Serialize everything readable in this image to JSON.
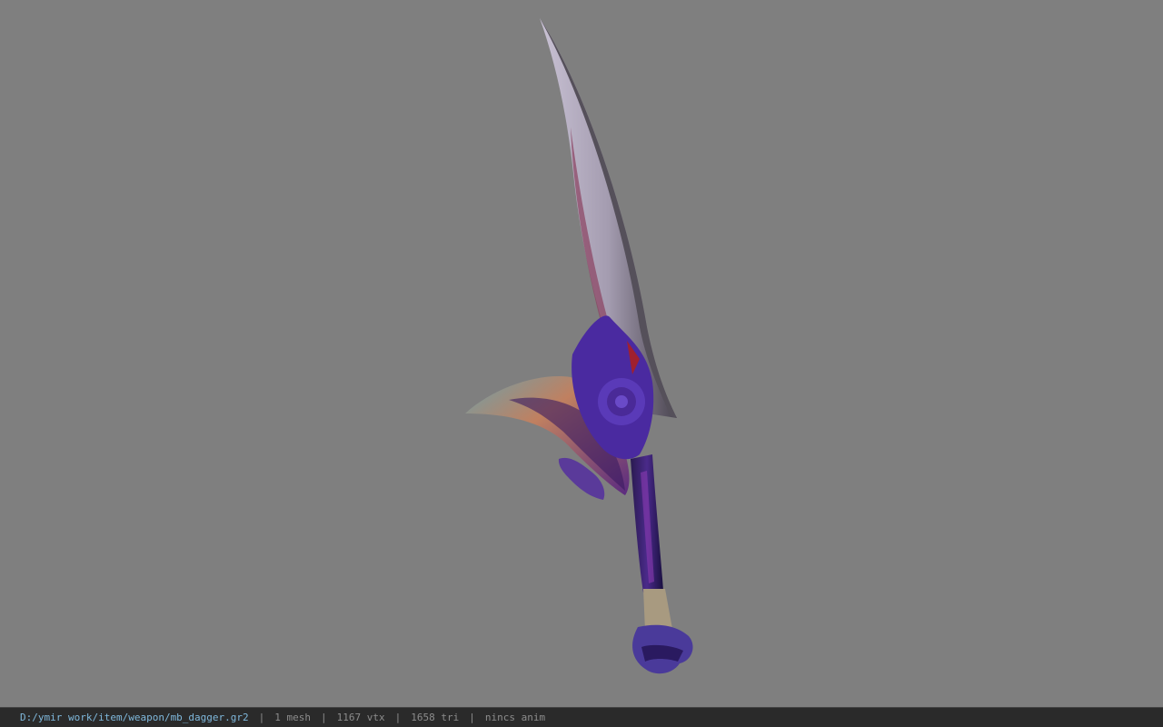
{
  "viewer": {
    "background_color": "#7f7f7f",
    "model_icon": "dagger-model"
  },
  "status": {
    "file_path": "D:/ymir work/item/weapon/mb_dagger.gr2",
    "mesh_count": "1 mesh",
    "vertex_count": "1167 vtx",
    "triangle_count": "1658 tri",
    "animation": "nincs anim",
    "separator": "|"
  }
}
